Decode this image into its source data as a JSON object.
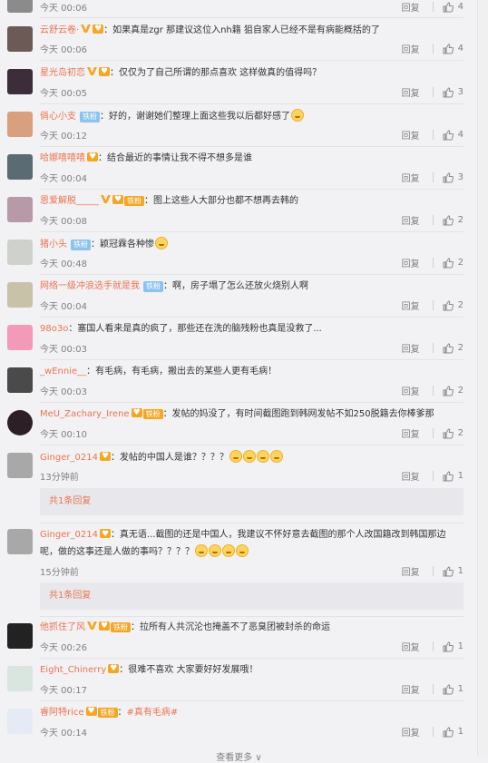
{
  "reply_label": "回复",
  "more_label": "查看更多 ∨",
  "comments": [
    {
      "user": "",
      "text": "",
      "time": "今天 00:06",
      "likes": "4",
      "avatar_color": "#8b8b8b"
    },
    {
      "user": "云舒云卷·",
      "text": "：如果真是zgr 那建议这位入nh籍 狙自家人已经不是有病能概括的了",
      "time": "今天 00:06",
      "likes": "4",
      "avatar_color": "#6b5a55"
    },
    {
      "user": "星光岛初恋",
      "text": "：仅仅为了自己所谓的那点喜欢 这样做真的值得吗？",
      "time": "今天 00:05",
      "likes": "3",
      "avatar_color": "#3d2c3a"
    },
    {
      "user": "倘心小支",
      "text": "：好的，谢谢她们整理上面这些我以后都好感了",
      "time": "今天 00:12",
      "likes": "4",
      "avatar_color": "#d9a07f"
    },
    {
      "user": "哈娜嘻嘻嘻",
      "text": "：结合最近的事情让我不得不想多是谁",
      "time": "今天 00:04",
      "likes": "3",
      "avatar_color": "#5a6b74"
    },
    {
      "user": "恩爱解脱_____",
      "text": "：图上这些人大部分也都不想再去韩的",
      "time": "今天 00:08",
      "likes": "2",
      "avatar_color": "#b79aa8"
    },
    {
      "user": "猪小头",
      "text": "：颖冠霖各种惨",
      "time": "今天 00:48",
      "likes": "2",
      "avatar_color": "#cfd2cc"
    },
    {
      "user": "网络一级冲浪选手就是我",
      "text": "：啊，房子塌了怎么还放火烧别人啊",
      "time": "今天 00:04",
      "likes": "2",
      "avatar_color": "#c8c2a8"
    },
    {
      "user": "98o3o",
      "text": "：塞国人看来是真的疯了，那些还在洗的脑残粉也真是没救了...",
      "time": "今天 00:03",
      "likes": "2",
      "avatar_color": "#f29ab8"
    },
    {
      "user": "_wEnnie__",
      "text": "：有毛病，有毛病，搬出去的某些人更有毛病！",
      "time": "今天 00:03",
      "likes": "2",
      "avatar_color": "#4a4a4a"
    },
    {
      "user": "MeU_Zachary_Irene",
      "text": "：发帖的妈没了，有时间截图跑到韩网发帖不如250脱籍去你棒爹那",
      "time": "今天 00:10",
      "likes": "2",
      "avatar_color": "#2d1f26"
    },
    {
      "user": "Ginger_0214",
      "text": "：发帖的中国人是谁？？？？",
      "time": "13分钟前",
      "likes": "1",
      "avatar_color": "#a8a8a8"
    },
    {
      "user": "Ginger_0214",
      "text": "：真无语...截图的还是中国人，我建议不怀好意去截图的那个人改国籍改到韩国那边呢，做的这事还是人做的事吗？？？？",
      "time": "15分钟前",
      "likes": "1",
      "avatar_color": "#a8a8a8"
    },
    {
      "user": "他抓住了风",
      "text": "：拉所有人共沉沦也掩盖不了恶臭团被封杀的命运",
      "time": "今天 00:26",
      "likes": "1",
      "avatar_color": "#222222"
    },
    {
      "user": "Eight_Chinerry",
      "text": "：很难不喜欢 大家要好好发展哦！",
      "time": "今天 00:17",
      "likes": "1",
      "avatar_color": "#d8e6df"
    },
    {
      "user": "睿阿特rice",
      "text": "：",
      "hashtag": "#真有毛病#",
      "time": "今天 00:14",
      "likes": "1",
      "avatar_color": "#e4ebf5"
    }
  ],
  "sub_replies": [
    "共1条回复",
    "共1条回复"
  ],
  "badges": {
    "iron_fan": "铁粉",
    "fan": "铁粉"
  }
}
